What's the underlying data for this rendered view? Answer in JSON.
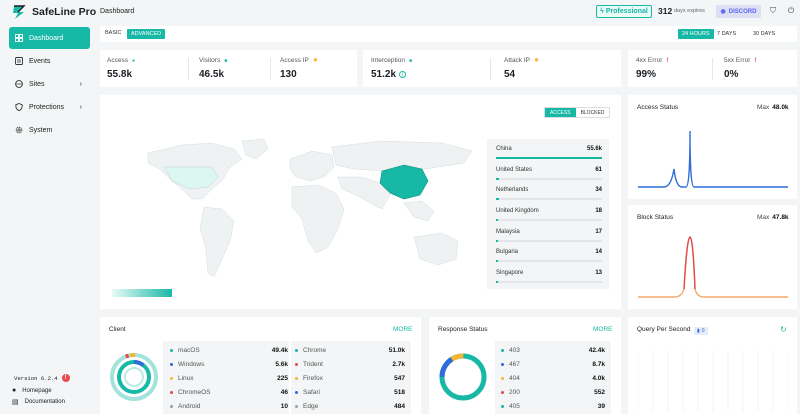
{
  "app": {
    "name": "SafeLine Pro",
    "version": "Version 6.2.4",
    "version_badge": "!"
  },
  "sidebar": {
    "items": [
      {
        "label": "Dashboard",
        "icon": "dashboard-icon",
        "active": true
      },
      {
        "label": "Events",
        "icon": "events-icon"
      },
      {
        "label": "Sites",
        "icon": "sites-icon",
        "chevron": "›"
      },
      {
        "label": "Protections",
        "icon": "shield-icon",
        "chevron": "›"
      },
      {
        "label": "System",
        "icon": "gear-icon"
      }
    ],
    "links": [
      {
        "label": "Homepage",
        "icon": "home-icon"
      },
      {
        "label": "Documentation",
        "icon": "doc-icon"
      }
    ]
  },
  "header": {
    "title": "Dashboard",
    "pro_label": "Professional",
    "days_count": "312",
    "days_label": "days expires",
    "discord_label": "DISCORD"
  },
  "mode": {
    "basic": "BASIC",
    "advanced": "ADVANCED",
    "ranges": [
      "24 HOURS",
      "7 DAYS",
      "30 DAYS"
    ]
  },
  "stats": {
    "access": {
      "label": "Access",
      "value": "55.8k"
    },
    "visitors": {
      "label": "Visitors",
      "value": "46.5k"
    },
    "access_ip": {
      "label": "Access IP",
      "value": "130"
    },
    "interception": {
      "label": "Interception",
      "value": "51.2k"
    },
    "attack_ip": {
      "label": "Attack IP",
      "value": "54"
    },
    "error_4xx": {
      "label": "4xx Error",
      "value": "99%"
    },
    "error_5xx": {
      "label": "5xx Error",
      "value": "0%"
    }
  },
  "map": {
    "toggle": [
      "ACCESS",
      "BLOCKED"
    ],
    "countries": [
      {
        "name": "China",
        "value": "55.6k",
        "share": 1.0
      },
      {
        "name": "United States",
        "value": "61",
        "share": 0.03
      },
      {
        "name": "Netherlands",
        "value": "34",
        "share": 0.025
      },
      {
        "name": "United Kingdom",
        "value": "18",
        "share": 0.02
      },
      {
        "name": "Malaysia",
        "value": "17",
        "share": 0.02
      },
      {
        "name": "Bulgaria",
        "value": "14",
        "share": 0.02
      },
      {
        "name": "Singapore",
        "value": "13",
        "share": 0.02
      }
    ]
  },
  "access_status": {
    "title": "Access Status",
    "max_label": "Max",
    "max_value": "48.0k",
    "color": "#2f6bd9"
  },
  "block_status": {
    "title": "Block Status",
    "max_label": "Max",
    "max_value": "47.8k",
    "color": "#e5484d"
  },
  "client": {
    "title": "Client",
    "more": "MORE",
    "os": [
      {
        "name": "macOS",
        "value": "49.4k",
        "color": "#18b8a6"
      },
      {
        "name": "Windows",
        "value": "5.6k",
        "color": "#2f6bd9"
      },
      {
        "name": "Linux",
        "value": "225",
        "color": "#f5b731"
      },
      {
        "name": "ChromeOS",
        "value": "46",
        "color": "#e5484d"
      },
      {
        "name": "Android",
        "value": "10",
        "color": "#9aa0a6"
      }
    ],
    "browsers": [
      {
        "name": "Chrome",
        "value": "51.0k",
        "color": "#18b8a6"
      },
      {
        "name": "Trident",
        "value": "2.7k",
        "color": "#e5484d"
      },
      {
        "name": "Firefox",
        "value": "547",
        "color": "#f5b731"
      },
      {
        "name": "Safari",
        "value": "518",
        "color": "#2f6bd9"
      },
      {
        "name": "Edge",
        "value": "484",
        "color": "#9aa0a6"
      }
    ]
  },
  "response": {
    "title": "Response Status",
    "more": "MORE",
    "codes": [
      {
        "name": "403",
        "value": "42.4k",
        "color": "#18b8a6"
      },
      {
        "name": "467",
        "value": "8.7k",
        "color": "#2f6bd9"
      },
      {
        "name": "404",
        "value": "4.0k",
        "color": "#f5b731"
      },
      {
        "name": "200",
        "value": "552",
        "color": "#e5484d"
      },
      {
        "name": "405",
        "value": "39",
        "color": "#18b8a6"
      }
    ]
  },
  "qps": {
    "title": "Query Per Second",
    "badge_value": "0"
  }
}
